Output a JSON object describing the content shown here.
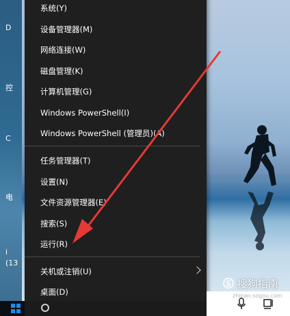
{
  "menu": {
    "items": [
      {
        "label": "系统(Y)"
      },
      {
        "label": "设备管理器(M)"
      },
      {
        "label": "网络连接(W)"
      },
      {
        "label": "磁盘管理(K)"
      },
      {
        "label": "计算机管理(G)"
      },
      {
        "label": "Windows PowerShell(I)"
      },
      {
        "label": "Windows PowerShell (管理员)(A)"
      },
      {
        "label": "任务管理器(T)"
      },
      {
        "label": "设置(N)"
      },
      {
        "label": "文件资源管理器(E)"
      },
      {
        "label": "搜索(S)"
      },
      {
        "label": "运行(R)"
      },
      {
        "label": "关机或注销(U)"
      },
      {
        "label": "桌面(D)"
      }
    ]
  },
  "desktop": {
    "fragments": [
      "D",
      "控",
      "C",
      "电",
      "i",
      "(13"
    ]
  },
  "watermark": {
    "text": "搜狗指南",
    "url": "zhinan.sogou.com"
  },
  "colors": {
    "menu_bg": "#1f1f1f",
    "arrow": "#e53935",
    "start_blue": "#1f8ae3"
  }
}
